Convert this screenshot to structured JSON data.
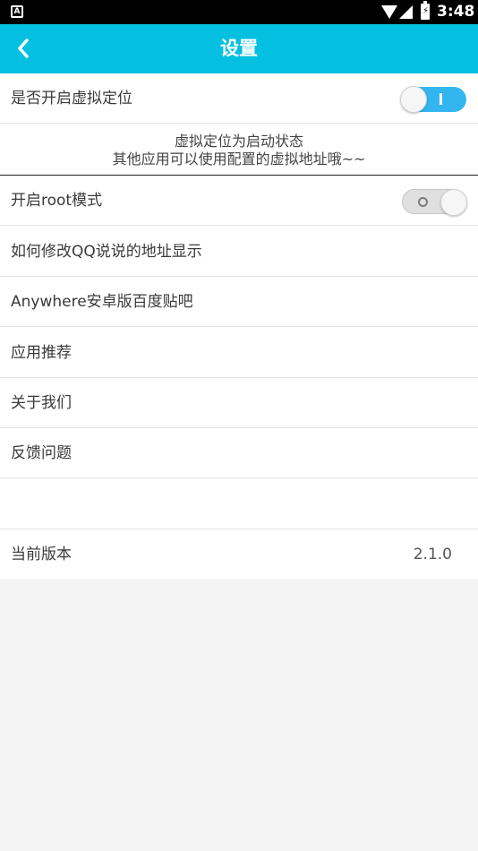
{
  "status_bar": {
    "time": "3:48",
    "notification_icon": "A",
    "battery_icon": "charging"
  },
  "app_bar": {
    "title": "设置",
    "back_icon": "chevron-left-icon"
  },
  "settings": {
    "virtual_location": {
      "label": "是否开启虚拟定位",
      "enabled": true
    },
    "info": {
      "line1": "虚拟定位为启动状态",
      "line2": "其他应用可以使用配置的虚拟地址哦~~"
    },
    "root_mode": {
      "label": "开启root模式",
      "enabled": false
    },
    "items": [
      {
        "label": "如何修改QQ说说的地址显示"
      },
      {
        "label": "Anywhere安卓版百度贴吧"
      },
      {
        "label": "应用推荐"
      },
      {
        "label": "关于我们"
      },
      {
        "label": "反馈问题"
      }
    ],
    "version": {
      "label": "当前版本",
      "value": "2.1.0"
    }
  },
  "colors": {
    "app_bar": "#05c0e0",
    "toggle_on": "#33b6ef",
    "background": "#f4f4f4"
  }
}
